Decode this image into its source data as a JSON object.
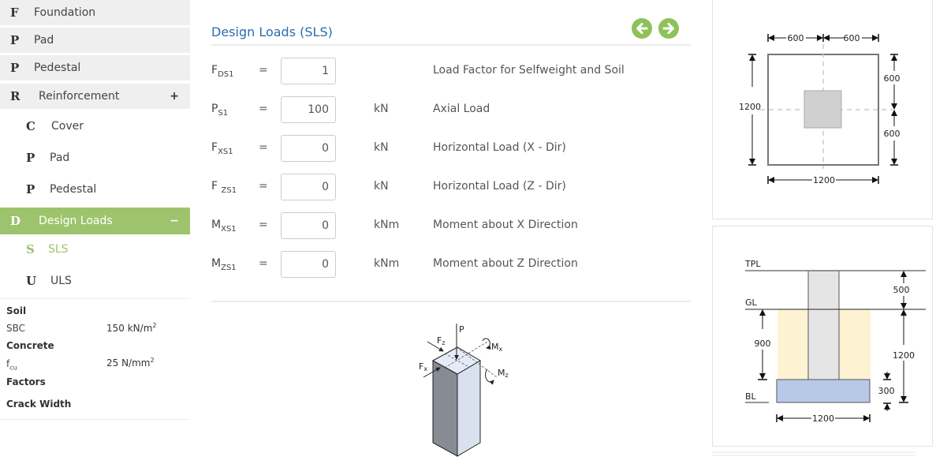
{
  "sidebar": {
    "items": [
      {
        "letter": "F",
        "label": "Foundation"
      },
      {
        "letter": "P",
        "label": "Pad"
      },
      {
        "letter": "P",
        "label": "Pedestal"
      },
      {
        "letter": "R",
        "label": "Reinforcement",
        "toggle": "+"
      },
      {
        "letter": "C",
        "label": "Cover"
      },
      {
        "letter": "P",
        "label": "Pad"
      },
      {
        "letter": "P",
        "label": "Pedestal"
      },
      {
        "letter": "D",
        "label": "Design Loads",
        "toggle": "−"
      },
      {
        "letter": "S",
        "label": "SLS"
      },
      {
        "letter": "U",
        "label": "ULS"
      }
    ],
    "summary": {
      "soil_heading": "Soil",
      "sbc_label": "SBC",
      "sbc_value": "150 kN/m",
      "sbc_exp": "2",
      "concrete_heading": "Concrete",
      "fcu_label": "f",
      "fcu_sub": "cu",
      "fcu_value": "25 N/mm",
      "fcu_exp": "2",
      "factors_heading": "Factors",
      "crack_heading": "Crack Width"
    }
  },
  "main": {
    "title": "Design Loads (SLS)",
    "prev_icon": "arrow-left-circle-icon",
    "next_icon": "arrow-right-circle-icon",
    "accent": "#8fc15b",
    "rows": [
      {
        "sym": "F",
        "sub": "DS1",
        "value": "1",
        "unit": "",
        "desc": "Load Factor for Selfweight and Soil"
      },
      {
        "sym": "P",
        "sub": "S1",
        "value": "100",
        "unit": "kN",
        "desc": "Axial Load"
      },
      {
        "sym": "F",
        "sub": "XS1",
        "value": "0",
        "unit": "kN",
        "desc": "Horizontal Load (X - Dir)"
      },
      {
        "sym": "F ",
        "sub": "ZS1",
        "value": "0",
        "unit": "kN",
        "desc": "Horizontal Load (Z - Dir)"
      },
      {
        "sym": "M",
        "sub": "XS1",
        "value": "0",
        "unit": "kNm",
        "desc": "Moment about X Direction"
      },
      {
        "sym": "M",
        "sub": "ZS1",
        "value": "0",
        "unit": "kNm",
        "desc": "Moment about Z Direction"
      }
    ],
    "equals": "=",
    "column_diagram": {
      "p": "P",
      "fz": "F",
      "fz_sub": "z",
      "fx": "F",
      "fx_sub": "x",
      "mx": "M",
      "mx_sub": "x",
      "mz": "M",
      "mz_sub": "z"
    }
  },
  "plan_view": {
    "top_left": "600",
    "top_right": "600",
    "right_top": "600",
    "right_bottom": "600",
    "left": "1200",
    "bottom": "1200"
  },
  "section_view": {
    "tpl": "TPL",
    "gl": "GL",
    "bl": "BL",
    "pedestal_above": "500",
    "soil_depth": "900",
    "total_depth": "1200",
    "pad_thickness": "300",
    "pad_width": "1200"
  }
}
